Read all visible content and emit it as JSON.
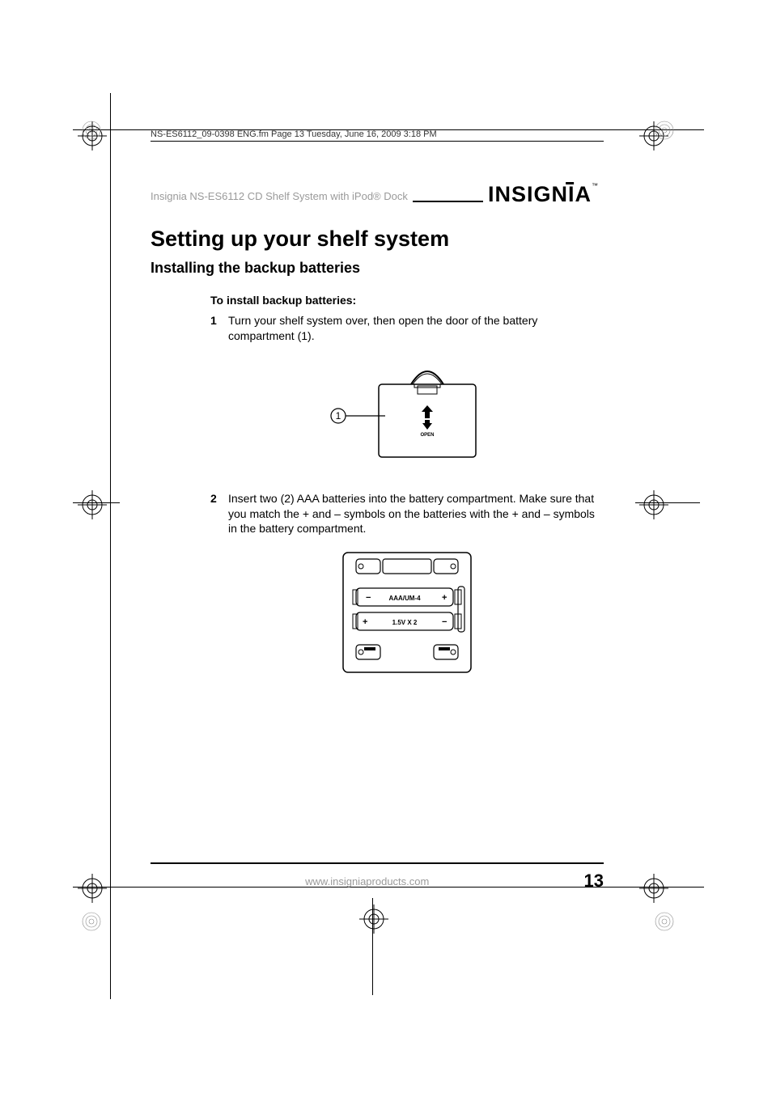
{
  "slug": "NS-ES6112_09-0398 ENG.fm  Page 13  Tuesday, June 16, 2009  3:18 PM",
  "header": {
    "running": "Insignia NS-ES6112 CD Shelf System with iPod® Dock",
    "brand": "INSIGNIA"
  },
  "title": "Setting up your shelf system",
  "subtitle": "Installing the backup batteries",
  "instructions": {
    "heading": "To install backup batteries:",
    "steps": [
      {
        "num": "1",
        "text": "Turn your shelf system over, then open the door of the battery compartment (1)."
      },
      {
        "num": "2",
        "text": "Insert two (2) AAA batteries into the battery compartment. Make sure that you match the + and – symbols on the batteries with the + and – symbols in the battery compartment."
      }
    ]
  },
  "fig1": {
    "callout": "1",
    "open_label": "OPEN"
  },
  "fig2": {
    "line1": "AAA/UM-4",
    "line2": "1.5V X 2"
  },
  "footer": {
    "url": "www.insigniaproducts.com",
    "page": "13"
  }
}
